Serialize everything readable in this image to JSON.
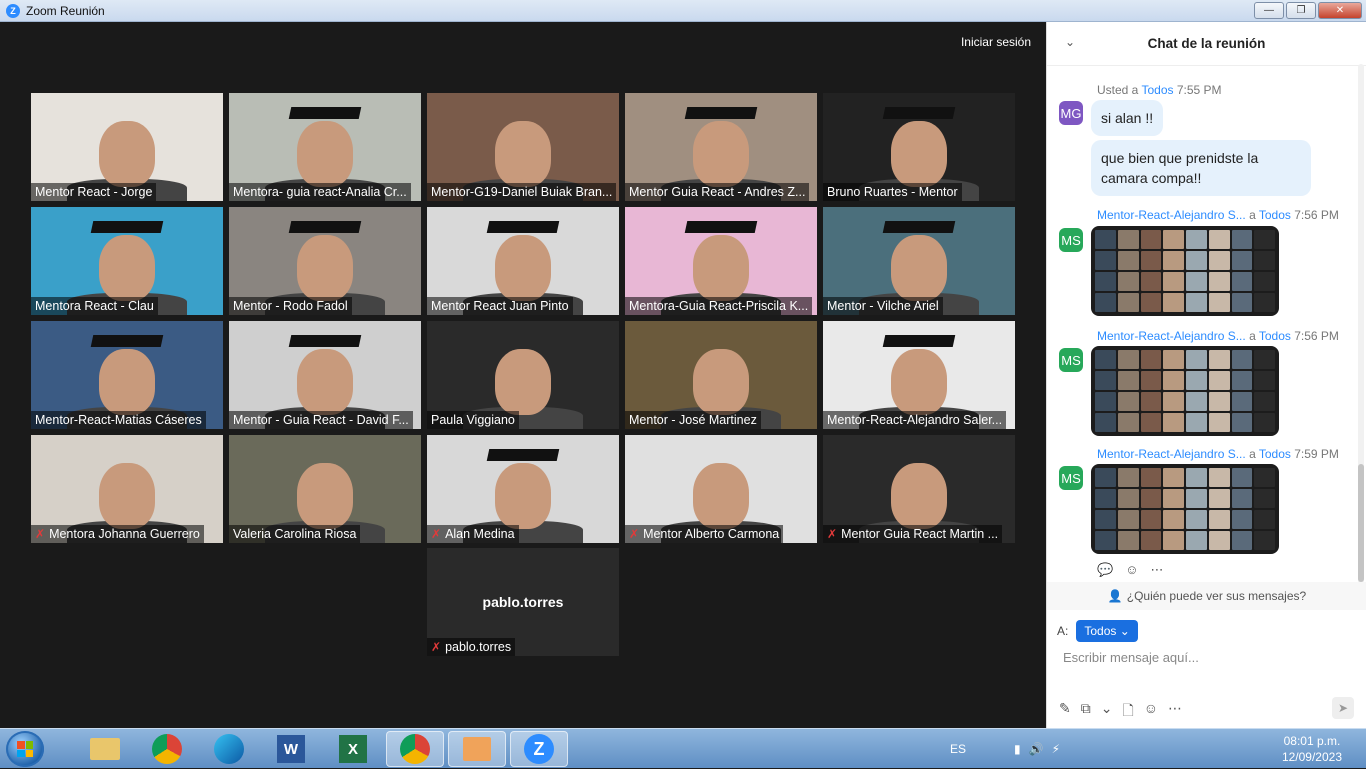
{
  "window": {
    "title": "Zoom Reunión",
    "minimize": "—",
    "restore": "❐",
    "close": "✕"
  },
  "video": {
    "signin_label": "Iniciar sesión",
    "tiles": [
      {
        "name": "Mentor React - Jorge",
        "muted": false,
        "active": false,
        "cap": false,
        "bg": "#e6e2dc"
      },
      {
        "name": "Mentora- guia react-Analia Cr...",
        "muted": false,
        "active": true,
        "cap": true,
        "bg": "#b9bdb5"
      },
      {
        "name": "Mentor-G19-Daniel Buiak Bran...",
        "muted": false,
        "active": false,
        "cap": false,
        "bg": "#7a5b4a"
      },
      {
        "name": "Mentor Guia React - Andres Z...",
        "muted": false,
        "active": false,
        "cap": true,
        "bg": "#a08f80"
      },
      {
        "name": "Bruno Ruartes - Mentor",
        "muted": false,
        "active": false,
        "cap": true,
        "bg": "#222222"
      },
      {
        "name": "Mentora React - Clau",
        "muted": false,
        "active": false,
        "cap": true,
        "bg": "#3aa0c9"
      },
      {
        "name": "Mentor - Rodo Fadol",
        "muted": false,
        "active": false,
        "cap": true,
        "bg": "#8a8580"
      },
      {
        "name": "Mentor React Juan Pinto",
        "muted": false,
        "active": false,
        "cap": true,
        "bg": "#d9d9d9"
      },
      {
        "name": "Mentora-Guia React-Priscila K...",
        "muted": false,
        "active": false,
        "cap": true,
        "bg": "#e8b7d5"
      },
      {
        "name": "Mentor - Vilche Ariel",
        "muted": false,
        "active": false,
        "cap": true,
        "bg": "#4b6f7c"
      },
      {
        "name": "Mentor-React-Matias Cáseres",
        "muted": false,
        "active": false,
        "cap": true,
        "bg": "#3b5b84"
      },
      {
        "name": "Mentor - Guia React - David F...",
        "muted": false,
        "active": false,
        "cap": true,
        "bg": "#cfcfcf"
      },
      {
        "name": "Paula Viggiano",
        "muted": false,
        "active": false,
        "cap": false,
        "bg": "#2a2a2a"
      },
      {
        "name": "Mentor - José Martinez",
        "muted": false,
        "active": false,
        "cap": false,
        "bg": "#6b5a3c"
      },
      {
        "name": "Mentor-React-Alejandro Saler...",
        "muted": false,
        "active": false,
        "cap": true,
        "bg": "#e9e9e9"
      },
      {
        "name": "Mentora Johanna Guerrero",
        "muted": true,
        "active": false,
        "cap": false,
        "bg": "#d6d0c8"
      },
      {
        "name": "Valeria Carolina Riosa",
        "muted": false,
        "active": false,
        "cap": false,
        "bg": "#6a6a5a"
      },
      {
        "name": "Alan Medina",
        "muted": true,
        "active": false,
        "cap": true,
        "bg": "#d8d8d8"
      },
      {
        "name": "Mentor Alberto Carmona",
        "muted": true,
        "active": false,
        "cap": false,
        "bg": "#e0e0e0"
      },
      {
        "name": "Mentor Guia React Martin ...",
        "muted": true,
        "active": false,
        "cap": false,
        "bg": "#2a2a2a"
      }
    ],
    "blank_tile": {
      "bigname": "pablo.torres",
      "name": "pablo.torres",
      "muted": true
    }
  },
  "chat": {
    "title": "Chat de la reunión",
    "messages": [
      {
        "meta_prefix": "Usted a ",
        "to": "Todos",
        "time": "7:55 PM",
        "avatar": "MG",
        "avatar_color": "#7e57c2",
        "lines": [
          "si alan !!",
          "que bien que prenidste la camara compa!!"
        ]
      },
      {
        "sender": "Mentor-React-Alejandro S...",
        "meta_a": " a ",
        "to": "Todos",
        "time": "7:56 PM",
        "avatar": "MS",
        "avatar_color": "#27a85a"
      },
      {
        "sender": "Mentor-React-Alejandro S...",
        "meta_a": " a ",
        "to": "Todos",
        "time": "7:56 PM",
        "avatar": "MS",
        "avatar_color": "#27a85a"
      },
      {
        "sender": "Mentor-React-Alejandro S...",
        "meta_a": " a ",
        "to": "Todos",
        "time": "7:59 PM",
        "avatar": "MS",
        "avatar_color": "#27a85a"
      }
    ],
    "who_can_see": "¿Quién puede ver sus mensajes?",
    "to_label": "A:",
    "to_value": "Todos",
    "input_placeholder": "Escribir mensaje aquí..."
  },
  "taskbar": {
    "apps": [
      "Explorador",
      "Chrome",
      "Edge",
      "Word",
      "Excel",
      "Chrome",
      "Tarjeta",
      "Zoom"
    ],
    "lang": "ES",
    "time": "08:01 p.m.",
    "date": "12/09/2023"
  }
}
